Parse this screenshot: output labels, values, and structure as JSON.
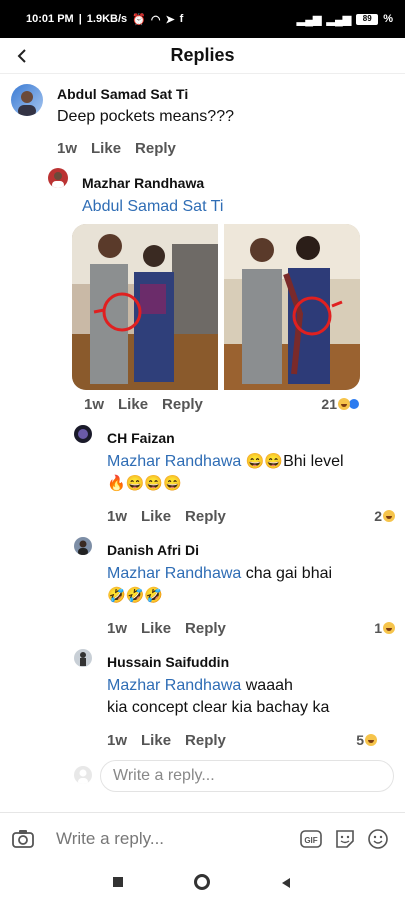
{
  "status": {
    "time": "10:01 PM",
    "speed": "1.9KB/s",
    "battery": "89"
  },
  "header": {
    "title": "Replies"
  },
  "comments": [
    {
      "name": "Abdul Samad Sat Ti",
      "text": "Deep pockets means???",
      "time": "1w",
      "like": "Like",
      "reply": "Reply"
    },
    {
      "name": "Mazhar Randhawa",
      "mention": "Abdul Samad Sat Ti",
      "time": "1w",
      "like": "Like",
      "reply": "Reply",
      "reactions": "21"
    },
    {
      "name": "CH Faizan",
      "mention": "Mazhar Randhawa",
      "text_line1": "Bhi level",
      "time": "1w",
      "like": "Like",
      "reply": "Reply",
      "reactions": "2"
    },
    {
      "name": "Danish Afri Di",
      "mention": "Mazhar Randhawa",
      "text_line1": "cha gai bhai",
      "time": "1w",
      "like": "Like",
      "reply": "Reply",
      "reactions": "1"
    },
    {
      "name": "Hussain Saifuddin",
      "mention": "Mazhar Randhawa",
      "text_line1": "waaah",
      "text_line2": "kia concept clear kia bachay ka",
      "time": "1w",
      "like": "Like",
      "reply": "Reply",
      "reactions": "5"
    }
  ],
  "reply_field": {
    "placeholder": "Write a reply..."
  },
  "bottom_bar": {
    "placeholder": "Write a reply..."
  },
  "icons": {
    "gif": "gif-icon",
    "sticker": "sticker-icon",
    "emoji": "emoji-icon",
    "camera": "camera-icon"
  },
  "colors": {
    "mention": "#2f6db5",
    "accent_like": "#2b7bf0"
  }
}
